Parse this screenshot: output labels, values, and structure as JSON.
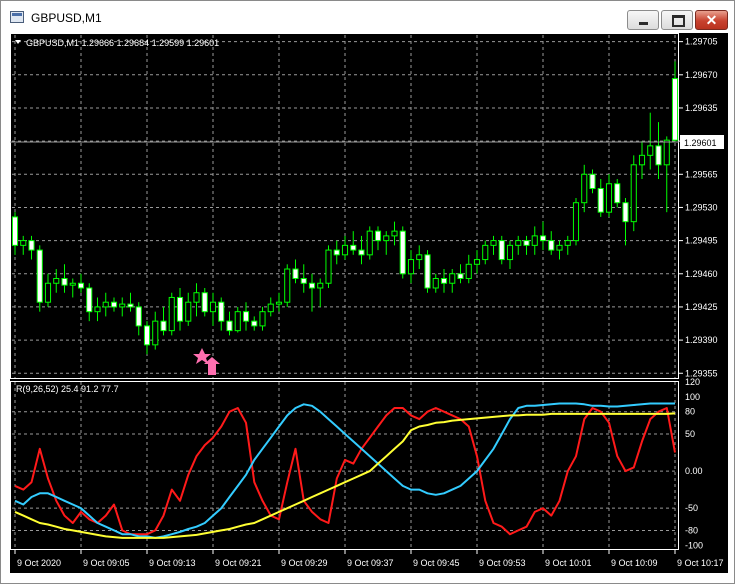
{
  "window": {
    "title": "GBPUSD,M1",
    "close_glyph": "✕",
    "icons": [
      "app-chart-icon",
      "minimize-icon",
      "maximize-icon",
      "close-icon"
    ]
  },
  "main_panel": {
    "symbol_line": "GBPUSD,M1  1.29666 1.29684 1.29599 1.29601",
    "price_levels": [
      "1.29705",
      "1.29670",
      "1.29635",
      "1.29600",
      "1.29565",
      "1.29530",
      "1.29495",
      "1.29460",
      "1.29425",
      "1.29390",
      "1.29355"
    ],
    "current_price": "1.29601",
    "trade_marker": "buy-arrow-icon",
    "marker_color": "#ff6fb0"
  },
  "indicator_panel": {
    "label": "R(9,26,52) 25.4 91.2 77.7",
    "levels": [
      "120",
      "100",
      "80",
      "50",
      "0.00",
      "-50",
      "-80",
      "-100"
    ],
    "colors": {
      "fast": "#ff1a1a",
      "medium": "#33ccff",
      "slow": "#ffff33"
    }
  },
  "time_axis": [
    "9 Oct 2020",
    "9 Oct 09:05",
    "9 Oct 09:13",
    "9 Oct 09:21",
    "9 Oct 09:29",
    "9 Oct 09:37",
    "9 Oct 09:45",
    "9 Oct 09:53",
    "9 Oct 10:01",
    "9 Oct 10:09",
    "9 Oct 10:17"
  ],
  "colors": {
    "background": "#000000",
    "grid": "#b0b0b0",
    "bull_candle": "#000000",
    "candle_outline": "#00ff00",
    "text": "#ffffff"
  },
  "chart_data": [
    {
      "type": "candlestick",
      "symbol": "GBPUSD",
      "timeframe": "M1",
      "ohlc_last": {
        "open": 1.29666,
        "high": 1.29684,
        "low": 1.29599,
        "close": 1.29601
      },
      "ylim": [
        1.2935,
        1.29712
      ],
      "x": [
        "09:00",
        "09:01",
        "09:02",
        "09:03",
        "09:04",
        "09:05",
        "09:06",
        "09:07",
        "09:08",
        "09:09",
        "09:10",
        "09:11",
        "09:12",
        "09:13",
        "09:14",
        "09:15",
        "09:16",
        "09:17",
        "09:18",
        "09:19",
        "09:20",
        "09:21",
        "09:22",
        "09:23",
        "09:24",
        "09:25",
        "09:26",
        "09:27",
        "09:28",
        "09:29",
        "09:30",
        "09:31",
        "09:32",
        "09:33",
        "09:34",
        "09:35",
        "09:36",
        "09:37",
        "09:38",
        "09:39",
        "09:40",
        "09:41",
        "09:42",
        "09:43",
        "09:44",
        "09:45",
        "09:46",
        "09:47",
        "09:48",
        "09:49",
        "09:50",
        "09:51",
        "09:52",
        "09:53",
        "09:54",
        "09:55",
        "09:56",
        "09:57",
        "09:58",
        "09:59",
        "10:00",
        "10:01",
        "10:02",
        "10:03",
        "10:04",
        "10:05",
        "10:06",
        "10:07",
        "10:08",
        "10:09",
        "10:10",
        "10:11",
        "10:12",
        "10:13",
        "10:14",
        "10:15",
        "10:16",
        "10:17",
        "10:18",
        "10:19",
        "10:20"
      ],
      "ohlc": [
        [
          1.2952,
          1.29525,
          1.2948,
          1.2949
        ],
        [
          1.2949,
          1.295,
          1.2948,
          1.29495
        ],
        [
          1.29495,
          1.295,
          1.29475,
          1.29485
        ],
        [
          1.29485,
          1.2949,
          1.2942,
          1.2943
        ],
        [
          1.2943,
          1.2946,
          1.29425,
          1.2945
        ],
        [
          1.2945,
          1.29465,
          1.2944,
          1.29455
        ],
        [
          1.29455,
          1.2947,
          1.2944,
          1.29448
        ],
        [
          1.29448,
          1.29455,
          1.29435,
          1.2945
        ],
        [
          1.2945,
          1.2946,
          1.2944,
          1.29445
        ],
        [
          1.29445,
          1.2945,
          1.2941,
          1.2942
        ],
        [
          1.2942,
          1.29435,
          1.2941,
          1.29425
        ],
        [
          1.29425,
          1.2944,
          1.29415,
          1.2943
        ],
        [
          1.2943,
          1.29435,
          1.2942,
          1.29425
        ],
        [
          1.29425,
          1.29435,
          1.29415,
          1.29428
        ],
        [
          1.29428,
          1.2944,
          1.2942,
          1.29425
        ],
        [
          1.29425,
          1.2943,
          1.29395,
          1.29405
        ],
        [
          1.29405,
          1.2941,
          1.29375,
          1.29385
        ],
        [
          1.29385,
          1.2942,
          1.2938,
          1.2941
        ],
        [
          1.2941,
          1.29425,
          1.29395,
          1.294
        ],
        [
          1.294,
          1.2944,
          1.29395,
          1.29435
        ],
        [
          1.29435,
          1.29445,
          1.294,
          1.2941
        ],
        [
          1.2941,
          1.2944,
          1.29405,
          1.2943
        ],
        [
          1.2943,
          1.2945,
          1.29415,
          1.2944
        ],
        [
          1.2944,
          1.29445,
          1.29415,
          1.2942
        ],
        [
          1.2942,
          1.2944,
          1.29405,
          1.2943
        ],
        [
          1.2943,
          1.29435,
          1.294,
          1.2941
        ],
        [
          1.2941,
          1.2942,
          1.29395,
          1.294
        ],
        [
          1.294,
          1.29425,
          1.29398,
          1.2942
        ],
        [
          1.2942,
          1.2943,
          1.294,
          1.2941
        ],
        [
          1.2941,
          1.29415,
          1.294,
          1.29405
        ],
        [
          1.29405,
          1.29425,
          1.294,
          1.2942
        ],
        [
          1.2942,
          1.29435,
          1.29415,
          1.29428
        ],
        [
          1.29428,
          1.2944,
          1.2942,
          1.2943
        ],
        [
          1.2943,
          1.2947,
          1.29425,
          1.29465
        ],
        [
          1.29465,
          1.29475,
          1.2945,
          1.29455
        ],
        [
          1.29455,
          1.2947,
          1.2944,
          1.2945
        ],
        [
          1.2945,
          1.2946,
          1.2942,
          1.29445
        ],
        [
          1.29445,
          1.29455,
          1.29425,
          1.2945
        ],
        [
          1.2945,
          1.2949,
          1.29445,
          1.29485
        ],
        [
          1.29485,
          1.29495,
          1.2947,
          1.2948
        ],
        [
          1.2948,
          1.295,
          1.29475,
          1.2949
        ],
        [
          1.2949,
          1.29505,
          1.2948,
          1.29485
        ],
        [
          1.29485,
          1.295,
          1.2947,
          1.2948
        ],
        [
          1.2948,
          1.2951,
          1.29475,
          1.29505
        ],
        [
          1.29505,
          1.2951,
          1.29485,
          1.29495
        ],
        [
          1.29495,
          1.29505,
          1.2948,
          1.295
        ],
        [
          1.295,
          1.29515,
          1.2949,
          1.29505
        ],
        [
          1.29505,
          1.2951,
          1.29455,
          1.2946
        ],
        [
          1.2946,
          1.29485,
          1.2945,
          1.29475
        ],
        [
          1.29475,
          1.2949,
          1.29465,
          1.2948
        ],
        [
          1.2948,
          1.29485,
          1.2944,
          1.29445
        ],
        [
          1.29445,
          1.2946,
          1.2944,
          1.29455
        ],
        [
          1.29455,
          1.29465,
          1.2944,
          1.2945
        ],
        [
          1.2945,
          1.29465,
          1.2944,
          1.2946
        ],
        [
          1.2946,
          1.2947,
          1.2945,
          1.29455
        ],
        [
          1.29455,
          1.2948,
          1.2945,
          1.2947
        ],
        [
          1.2947,
          1.29485,
          1.2946,
          1.29475
        ],
        [
          1.29475,
          1.29495,
          1.2947,
          1.2949
        ],
        [
          1.2949,
          1.295,
          1.2948,
          1.29495
        ],
        [
          1.29495,
          1.295,
          1.2947,
          1.29475
        ],
        [
          1.29475,
          1.29495,
          1.29465,
          1.2949
        ],
        [
          1.2949,
          1.295,
          1.2948,
          1.29495
        ],
        [
          1.29495,
          1.295,
          1.2948,
          1.2949
        ],
        [
          1.2949,
          1.2951,
          1.2948,
          1.295
        ],
        [
          1.295,
          1.29515,
          1.29485,
          1.29495
        ],
        [
          1.29495,
          1.29505,
          1.2948,
          1.29485
        ],
        [
          1.29485,
          1.29495,
          1.29475,
          1.2949
        ],
        [
          1.2949,
          1.295,
          1.2948,
          1.29495
        ],
        [
          1.29495,
          1.2954,
          1.2949,
          1.29535
        ],
        [
          1.29535,
          1.29575,
          1.29525,
          1.29565
        ],
        [
          1.29565,
          1.2957,
          1.29545,
          1.2955
        ],
        [
          1.2955,
          1.2956,
          1.2952,
          1.29525
        ],
        [
          1.29525,
          1.29565,
          1.2952,
          1.29555
        ],
        [
          1.29555,
          1.2956,
          1.2953,
          1.29535
        ],
        [
          1.29535,
          1.2954,
          1.2949,
          1.29515
        ],
        [
          1.29515,
          1.29585,
          1.29505,
          1.29575
        ],
        [
          1.29575,
          1.296,
          1.2956,
          1.29585
        ],
        [
          1.29585,
          1.2963,
          1.2957,
          1.29595
        ],
        [
          1.29595,
          1.2962,
          1.2956,
          1.29575
        ],
        [
          1.29575,
          1.29605,
          1.29525,
          1.29601
        ],
        [
          1.29666,
          1.29684,
          1.29599,
          1.29601
        ]
      ]
    },
    {
      "type": "line",
      "label": "R(9,26,52) 25.4 91.2 77.7",
      "ylim": [
        -105,
        120
      ],
      "series": [
        {
          "color": "#ff1a1a",
          "values": [
            -20,
            -25,
            -15,
            30,
            -10,
            -40,
            -60,
            -70,
            -55,
            -65,
            -70,
            -60,
            -45,
            -80,
            -85,
            -85,
            -85,
            -80,
            -60,
            -25,
            -40,
            -5,
            20,
            35,
            45,
            60,
            80,
            85,
            65,
            -15,
            -40,
            -60,
            -65,
            -15,
            30,
            -40,
            -55,
            -65,
            -70,
            -10,
            15,
            10,
            30,
            45,
            60,
            75,
            85,
            85,
            75,
            70,
            80,
            85,
            80,
            75,
            70,
            60,
            20,
            -40,
            -70,
            -75,
            -85,
            -80,
            -75,
            -55,
            -50,
            -60,
            -40,
            0,
            20,
            70,
            85,
            80,
            65,
            20,
            0,
            5,
            40,
            70,
            80,
            85,
            25
          ]
        },
        {
          "color": "#33ccff",
          "values": [
            -40,
            -45,
            -35,
            -30,
            -30,
            -35,
            -40,
            -45,
            -50,
            -60,
            -70,
            -75,
            -80,
            -85,
            -85,
            -88,
            -88,
            -90,
            -88,
            -85,
            -82,
            -78,
            -75,
            -70,
            -60,
            -50,
            -35,
            -20,
            -5,
            15,
            30,
            45,
            60,
            75,
            85,
            90,
            88,
            80,
            70,
            60,
            50,
            40,
            30,
            20,
            10,
            0,
            -10,
            -20,
            -25,
            -25,
            -30,
            -32,
            -30,
            -25,
            -20,
            -10,
            0,
            15,
            30,
            50,
            70,
            85,
            88,
            88,
            89,
            90,
            91,
            91,
            91,
            90,
            88,
            88,
            87,
            87,
            88,
            89,
            90,
            91,
            91,
            91,
            91
          ]
        },
        {
          "color": "#ffff33",
          "values": [
            -55,
            -60,
            -65,
            -70,
            -72,
            -75,
            -78,
            -80,
            -82,
            -84,
            -86,
            -88,
            -89,
            -90,
            -90,
            -90,
            -90,
            -90,
            -90,
            -89,
            -88,
            -87,
            -86,
            -84,
            -82,
            -80,
            -78,
            -75,
            -72,
            -70,
            -65,
            -60,
            -55,
            -50,
            -45,
            -40,
            -35,
            -30,
            -25,
            -20,
            -15,
            -10,
            -5,
            0,
            10,
            20,
            30,
            40,
            55,
            60,
            62,
            65,
            66,
            68,
            69,
            70,
            71,
            72,
            73,
            74,
            75,
            75,
            76,
            76,
            76,
            77,
            77,
            77,
            77,
            77,
            77,
            77,
            77,
            77,
            77,
            77,
            77,
            77,
            77,
            77,
            77.7
          ]
        }
      ]
    }
  ]
}
